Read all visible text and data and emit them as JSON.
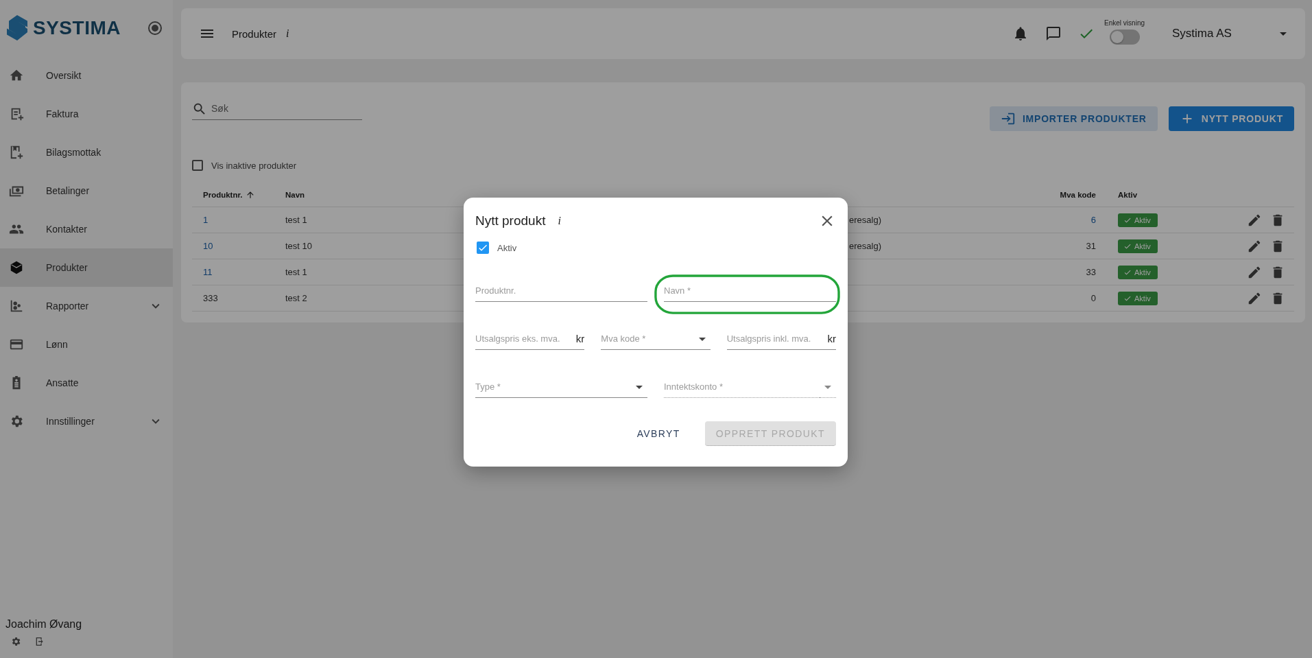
{
  "sidebar": {
    "logo": "SYSTIMA",
    "items": [
      {
        "label": "Oversikt",
        "selected": false,
        "expandable": false
      },
      {
        "label": "Faktura",
        "selected": false,
        "expandable": false
      },
      {
        "label": "Bilagsmottak",
        "selected": false,
        "expandable": false
      },
      {
        "label": "Betalinger",
        "selected": false,
        "expandable": false
      },
      {
        "label": "Kontakter",
        "selected": false,
        "expandable": false
      },
      {
        "label": "Produkter",
        "selected": true,
        "expandable": false
      },
      {
        "label": "Rapporter",
        "selected": false,
        "expandable": true
      },
      {
        "label": "Lønn",
        "selected": false,
        "expandable": false
      },
      {
        "label": "Ansatte",
        "selected": false,
        "expandable": false
      },
      {
        "label": "Innstillinger",
        "selected": false,
        "expandable": true
      }
    ],
    "user": "Joachim Øvang"
  },
  "header": {
    "title": "Produkter",
    "info": "i",
    "sync_ok": true,
    "toggle": {
      "label": "Enkel visning",
      "on": false
    },
    "company": "Systima AS"
  },
  "toolbar": {
    "search": {
      "placeholder": "Søk"
    },
    "buttons": [
      {
        "label": "IMPORTER PRODUKTER",
        "kind": "secondary"
      },
      {
        "label": "NYTT PRODUKT",
        "kind": "primary"
      }
    ],
    "show_inactive": {
      "label": "Vis inaktive produkter",
      "checked": false
    }
  },
  "table": {
    "columns": [
      {
        "label": "Produktnr.",
        "sorted": true
      },
      {
        "label": "Navn",
        "sorted": false
      },
      {
        "label": "Mva kode",
        "sorted": false
      },
      {
        "label": "Aktiv",
        "sorted": false
      }
    ],
    "rows": [
      {
        "produktnr": "1",
        "produktnr_link": true,
        "navn": "test 1",
        "column_3": "eresalg)",
        "mva_kode": "6",
        "mva_link": true,
        "aktiv": {
          "label": "Aktiv",
          "on": true
        }
      },
      {
        "produktnr": "10",
        "produktnr_link": true,
        "navn": "test 10",
        "column_3": "eresalg)",
        "mva_kode": "31",
        "mva_link": false,
        "aktiv": {
          "label": "Aktiv",
          "on": true
        }
      },
      {
        "produktnr": "11",
        "produktnr_link": true,
        "navn": "test 1",
        "mva_kode": "33",
        "mva_link": false,
        "aktiv": {
          "label": "Aktiv",
          "on": true
        }
      },
      {
        "produktnr": "333",
        "produktnr_link": false,
        "navn": "test 2",
        "mva_kode": "0",
        "mva_link": false,
        "aktiv": {
          "label": "Aktiv",
          "on": true
        }
      }
    ]
  },
  "dialog": {
    "title": "Nytt produkt",
    "info": "i",
    "active": {
      "label": "Aktiv",
      "checked": true
    },
    "field_rows": [
      [
        {
          "kind": "text",
          "placeholder": "Produktnr.",
          "disabled": false
        },
        {
          "kind": "text",
          "placeholder": "Navn *",
          "highlighted": true,
          "disabled": false
        }
      ],
      [
        {
          "kind": "currency",
          "placeholder": "Utsalgspris eks. mva.",
          "suffix": "kr",
          "disabled": false
        },
        {
          "kind": "select",
          "placeholder": "Mva kode *",
          "disabled": false
        },
        {
          "kind": "currency",
          "placeholder": "Utsalgspris inkl. mva.",
          "suffix": "kr",
          "disabled": false
        }
      ],
      [
        {
          "kind": "select",
          "placeholder": "Type *",
          "disabled": false
        },
        {
          "kind": "select",
          "placeholder": "Inntektskonto *",
          "disabled": true
        }
      ]
    ],
    "buttons": [
      {
        "label": "AVBRYT",
        "disabled": false
      },
      {
        "label": "OPPRETT PRODUKT",
        "disabled": true
      }
    ]
  }
}
